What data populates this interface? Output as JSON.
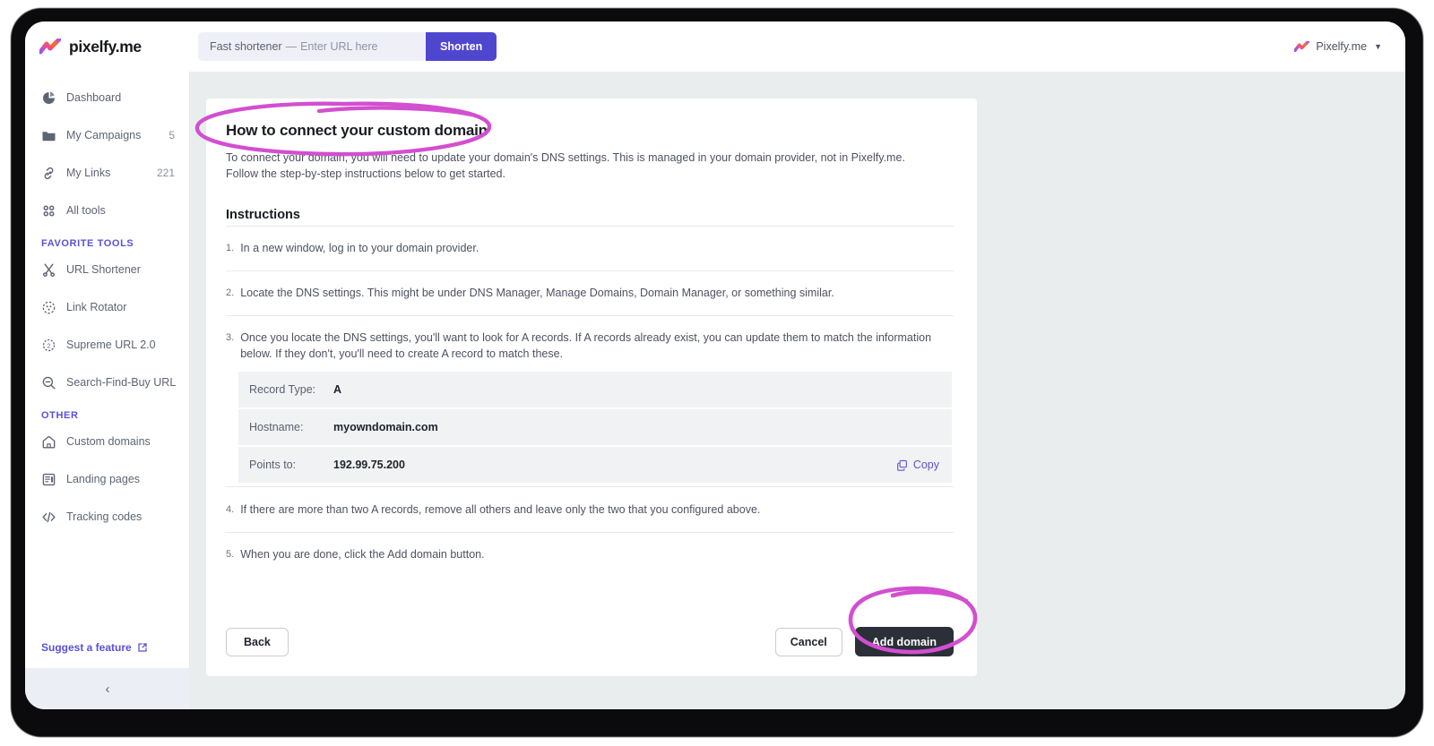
{
  "colors": {
    "accent_indigo": "#4f46cf",
    "brand_violet": "#5a51d8",
    "annotation_magenta": "#d24fd0",
    "page_bg": "#e9edee",
    "dark_button": "#2b2f38",
    "text_muted": "#5d6474"
  },
  "topbar": {
    "brand_name": "pixelfy.me",
    "brand_logo_icon": "pixelfy-gradient-logo-icon",
    "shortener": {
      "lead_label": "Fast shortener",
      "separator": "—",
      "placeholder": "Enter URL here",
      "value": "",
      "button_label": "Shorten"
    },
    "user_menu": {
      "label": "Pixelfy.me",
      "avatar_icon": "pixelfy-gradient-logo-icon",
      "caret_icon": "chevron-down-icon"
    }
  },
  "sidebar": {
    "main_items": [
      {
        "label": "Dashboard",
        "icon": "pie-chart-icon",
        "count": ""
      },
      {
        "label": "My Campaigns",
        "icon": "folder-icon",
        "count": "5"
      },
      {
        "label": "My Links",
        "icon": "link-icon",
        "count": "221"
      },
      {
        "label": "All tools",
        "icon": "grid-dots-icon",
        "count": ""
      }
    ],
    "favorite_tools_title": "FAVORITE TOOLS",
    "favorite_tools": [
      {
        "label": "URL Shortener",
        "icon": "scissors-icon"
      },
      {
        "label": "Link Rotator",
        "icon": "rotator-circle-icon"
      },
      {
        "label": "Supreme URL 2.0",
        "icon": "gear-two-icon"
      },
      {
        "label": "Search-Find-Buy URL",
        "icon": "search-minus-icon"
      }
    ],
    "other_title": "OTHER",
    "other_items": [
      {
        "label": "Custom domains",
        "icon": "home-icon"
      },
      {
        "label": "Landing pages",
        "icon": "page-icon"
      },
      {
        "label": "Tracking codes",
        "icon": "code-brackets-icon"
      }
    ],
    "suggest_label": "Suggest a feature",
    "suggest_icon": "external-link-icon",
    "collapse_icon": "chevron-left-icon"
  },
  "main": {
    "title": "How to connect your custom domain",
    "intro": "To connect your domain, you will need to update your domain's DNS settings. This is managed in your domain provider, not in Pixelfy.me. Follow the step-by-step instructions below to get started.",
    "instructions_heading": "Instructions",
    "steps": [
      {
        "num": "1.",
        "text": "In a new window, log in to your domain provider."
      },
      {
        "num": "2.",
        "text": "Locate the DNS settings. This might be under DNS Manager, Manage Domains, Domain Manager, or something similar."
      },
      {
        "num": "3.",
        "text": "Once you locate the DNS settings, you'll want to look for A records. If A records already exist, you can update them to match the information below. If they don't, you'll need to create A record to match these."
      },
      {
        "num": "4.",
        "text": "If there are more than two A records, remove all others and leave only the two that you configured above."
      },
      {
        "num": "5.",
        "text": "When you are done, click the Add domain button."
      }
    ],
    "dns_records": [
      {
        "key": "Record Type:",
        "value": "A",
        "copy": ""
      },
      {
        "key": "Hostname:",
        "value": "myowndomain.com",
        "copy": ""
      },
      {
        "key": "Points to:",
        "value": "192.99.75.200",
        "copy": "Copy"
      }
    ],
    "copy_icon": "copy-icon",
    "buttons": {
      "back": "Back",
      "cancel": "Cancel",
      "add_domain": "Add domain"
    }
  },
  "annotations": [
    {
      "name": "title-ellipse",
      "target": "How to connect your custom domain"
    },
    {
      "name": "add-domain-ellipse",
      "target": "Add domain"
    }
  ]
}
